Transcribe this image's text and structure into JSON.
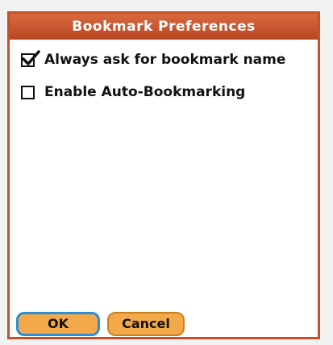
{
  "dialog": {
    "title": "Bookmark Preferences",
    "options": [
      {
        "label": "Always ask for bookmark name",
        "checked": true,
        "icon": "checkmark-icon"
      },
      {
        "label": "Enable Auto-Bookmarking",
        "checked": false,
        "icon": "checkbox-empty-icon"
      }
    ],
    "buttons": {
      "ok_label": "OK",
      "cancel_label": "Cancel"
    },
    "colors": {
      "title_bar": "#c2522c",
      "button_fill": "#f3a94a",
      "focus_ring": "#2a8fd8"
    }
  }
}
